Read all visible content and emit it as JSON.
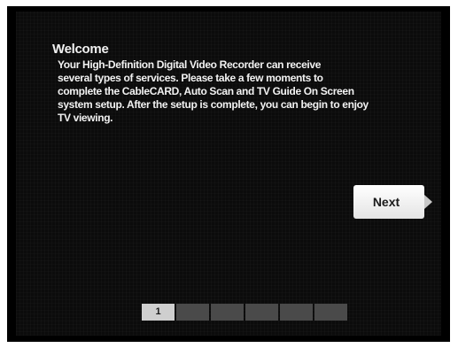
{
  "welcome": {
    "title": "Welcome",
    "lines": [
      "Your High-Definition Digital Video Recorder can receive",
      "several types of services. Please take a few moments to",
      "complete the CableCARD, Auto Scan and TV Guide On Screen",
      "system setup. After the setup is complete, you can begin to enjoy",
      "TV viewing."
    ]
  },
  "navigation": {
    "next_label": "Next"
  },
  "progress": {
    "total_steps": 6,
    "current_step": 1,
    "current_label": "1"
  },
  "colors": {
    "background": "#000000",
    "text": "#f2f2f2",
    "button": "#f5f5f5",
    "step_active": "#cfcfcf",
    "step_inactive": "#4a4a4a"
  }
}
